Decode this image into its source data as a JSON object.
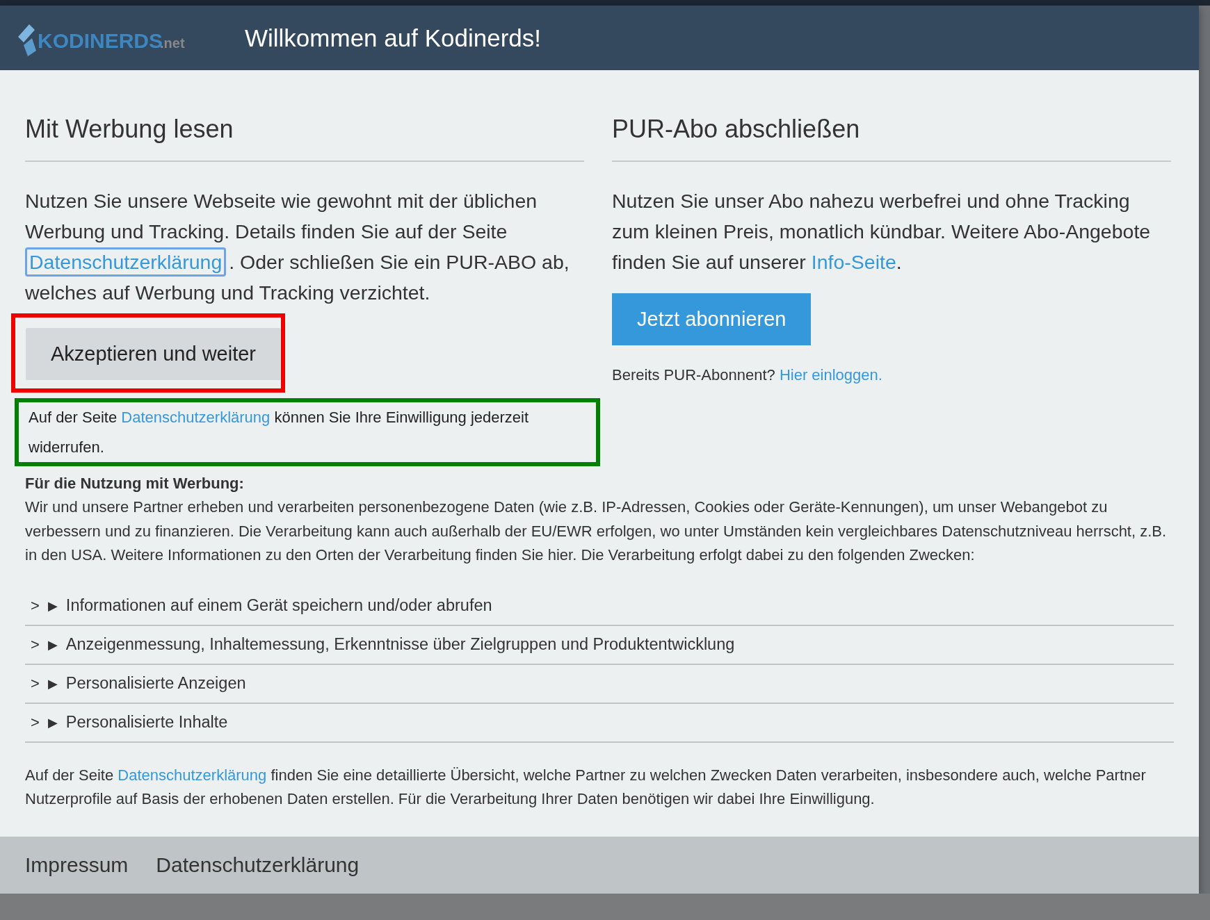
{
  "header": {
    "logo": {
      "name": "KODINERDS",
      "suffix": ".net"
    },
    "title": "Willkommen auf Kodinerds!"
  },
  "left": {
    "heading": "Mit Werbung lesen",
    "intro": {
      "before": "Nutzen Sie unsere Webseite wie gewohnt mit der üblichen Werbung und Tracking. Details finden Sie auf der Seite ",
      "link": "Datenschutzerklärung",
      "link_focused": true,
      "after": ". Oder schließen Sie ein PUR-ABO ab, welches auf Werbung und Tracking verzichtet."
    },
    "accept_button": {
      "label": "Akzeptieren und weiter",
      "color": "#ee0000"
    },
    "revoke_note": {
      "before": "Auf der Seite ",
      "link": "Datenschutzerklärung",
      "after": " können Sie Ihre Einwilligung jederzeit widerrufen.",
      "color": "#008000"
    }
  },
  "right": {
    "heading": "PUR-Abo abschließen",
    "intro": {
      "before": "Nutzen Sie unser Abo nahezu werbefrei und ohne Tracking zum kleinen Preis, monatlich kündbar. Weitere Abo-Angebote finden Sie auf unserer ",
      "link": "Info-Seite",
      "after": "."
    },
    "subscribe_button": "Jetzt abonnieren",
    "login": {
      "before": "Bereits PUR-Abonnent? ",
      "link": "Hier einloggen."
    }
  },
  "usage": {
    "title": "Für die Nutzung mit Werbung:",
    "text": "Wir und unsere Partner erheben und verarbeiten personenbezogene Daten (wie z.B. IP-Adressen, Cookies oder Geräte-Kennungen), um unser Webangebot zu verbessern und zu finanzieren. Die Verarbeitung kann auch außerhalb der EU/EWR erfolgen, wo unter Umständen kein vergleichbares Datenschutzniveau herrscht, z.B. in den USA. Weitere Informationen zu den Orten der Verarbeitung finden Sie hier. Die Verarbeitung erfolgt dabei zu den folgenden Zwecken:"
  },
  "purposes": [
    {
      "chevron": ">",
      "marker": "▶",
      "label": "Informationen auf einem Gerät speichern und/oder abrufen",
      "expanded": false
    },
    {
      "chevron": ">",
      "marker": "▶",
      "label": "Anzeigenmessung, Inhaltemessung, Erkenntnisse über Zielgruppen und Produktentwicklung",
      "expanded": false
    },
    {
      "chevron": ">",
      "marker": "▶",
      "label": "Personalisierte Anzeigen",
      "expanded": false
    },
    {
      "chevron": ">",
      "marker": "▶",
      "label": "Personalisierte Inhalte",
      "expanded": false
    }
  ],
  "details": {
    "before": "Auf der Seite ",
    "link": "Datenschutzerklärung",
    "after": " finden Sie eine detaillierte Übersicht, welche Partner zu welchen Zwecken Daten verarbeiten, insbesondere auch, welche Partner Nutzerprofile auf Basis der erhobenen Daten erstellen. Für die Verarbeitung Ihrer Daten benötigen wir dabei Ihre Einwilligung."
  },
  "footer_links": [
    "Impressum",
    "Datenschutzerklärung"
  ]
}
